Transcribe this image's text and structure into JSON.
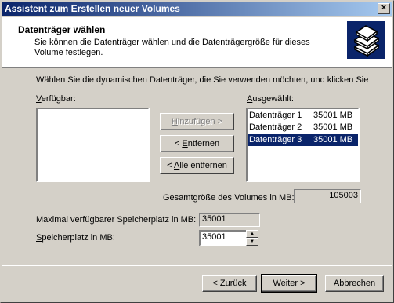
{
  "window": {
    "title": "Assistent zum Erstellen neuer Volumes",
    "close_glyph": "×"
  },
  "header": {
    "title": "Datenträger wählen",
    "subtitle": "Sie können die Datenträger wählen und die Datenträgergröße für dieses Volume festlegen.",
    "icon": "disk-stack-icon"
  },
  "instruction": "Wählen Sie die dynamischen Datenträger, die Sie verwenden möchten, und klicken Sie",
  "available": {
    "label_first": "V",
    "label_rest": "erfügbar:",
    "items": []
  },
  "selected": {
    "label_first": "A",
    "label_rest": "usgewählt:",
    "items": [
      {
        "name": "Datenträger 1",
        "size": "35001 MB",
        "selected": false
      },
      {
        "name": "Datenträger 2",
        "size": "35001 MB",
        "selected": false
      },
      {
        "name": "Datenträger 3",
        "size": "35001 MB",
        "selected": true
      }
    ]
  },
  "buttons": {
    "add": {
      "pre": "",
      "u": "H",
      "post": "inzufügen >"
    },
    "remove": {
      "pre": "< ",
      "u": "E",
      "post": "ntfernen"
    },
    "remove_all": {
      "pre": "< ",
      "u": "A",
      "post": "lle entfernen"
    },
    "back": {
      "pre": "< ",
      "u": "Z",
      "post": "urück"
    },
    "next": {
      "pre": "",
      "u": "W",
      "post": "eiter >"
    },
    "cancel": "Abbrechen"
  },
  "total_size": {
    "label": "Gesamtgröße des Volumes in MB:",
    "value": "105003"
  },
  "max_space": {
    "label": "Maximal verfügbarer Speicherplatz in MB:",
    "value": "35001"
  },
  "space": {
    "label_first": "S",
    "label_rest": "peicherplatz in MB:",
    "value": "35001",
    "up_glyph": "▲",
    "down_glyph": "▼"
  }
}
